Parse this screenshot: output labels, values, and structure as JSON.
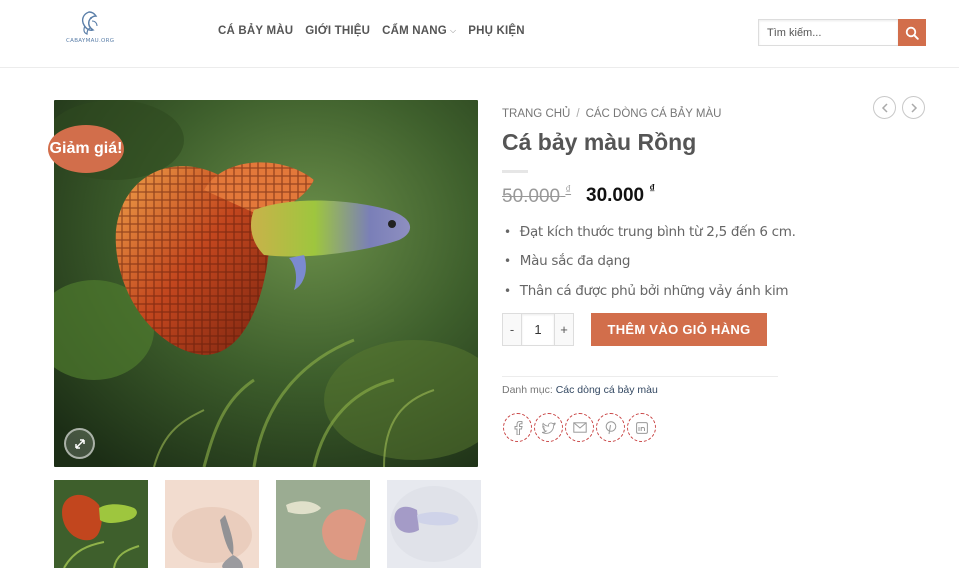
{
  "logo": {
    "text": "CABAYMAU.ORG"
  },
  "nav": {
    "items": [
      {
        "label": "CÁ BẢY MÀU"
      },
      {
        "label": "GIỚI THIỆU"
      },
      {
        "label": "CẨM NANG",
        "has_dropdown": true
      },
      {
        "label": "PHỤ KIỆN"
      }
    ]
  },
  "search": {
    "placeholder": "Tìm kiếm..."
  },
  "colors": {
    "accent": "#d26e4b",
    "link": "#334862"
  },
  "product": {
    "sale_badge": "Giảm giá!",
    "breadcrumb": [
      "TRANG CHỦ",
      "CÁC DÒNG CÁ BẢY MÀU"
    ],
    "breadcrumb_sep": "/",
    "title": "Cá bảy màu Rồng",
    "price_old": "50.000",
    "price_new": "30.000",
    "currency": "₫",
    "bullets": [
      "Đạt kích thước trung bình từ 2,5 đến 6 cm.",
      "Màu sắc đa dạng",
      "Thân cá được phủ bởi những vảy ánh kim"
    ],
    "quantity": "1",
    "qty_minus": "-",
    "qty_plus": "+",
    "add_to_cart": "THÊM VÀO GIỎ HÀNG",
    "category_label": "Danh mục:",
    "category_value": "Các dòng cá bảy màu"
  },
  "icons": {
    "search": "search-icon",
    "prev": "chevron-left-icon",
    "next": "chevron-right-icon",
    "zoom": "expand-icon",
    "share": [
      "facebook-icon",
      "twitter-icon",
      "email-icon",
      "pinterest-icon",
      "linkedin-icon"
    ]
  }
}
